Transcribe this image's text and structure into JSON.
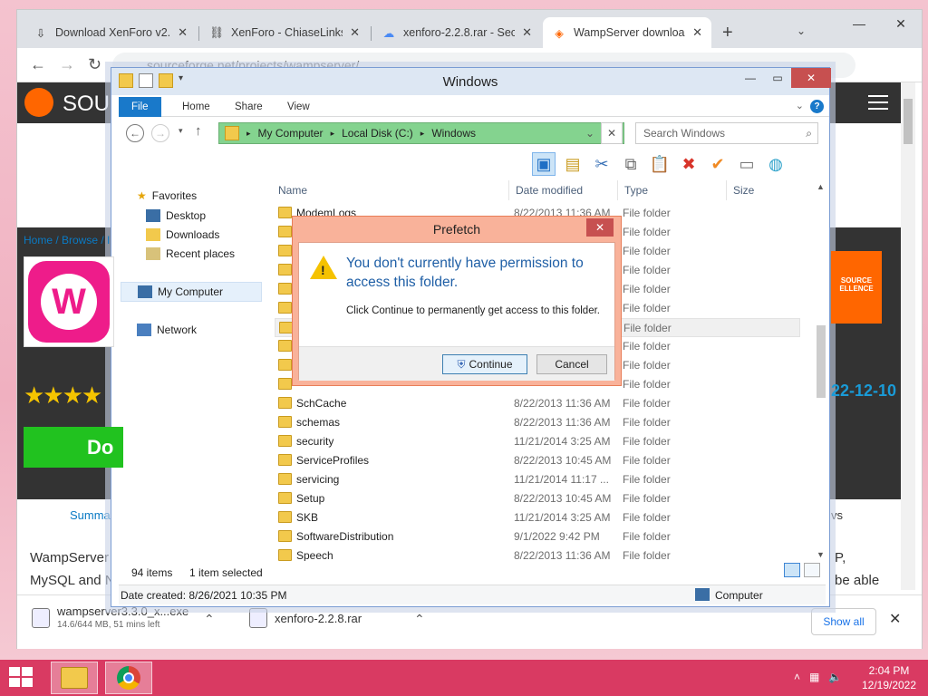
{
  "browser": {
    "tabs": [
      {
        "label": "Download XenForo v2.2",
        "icon": "download-icon"
      },
      {
        "label": "XenForo - ChiaseLinks",
        "icon": "link-icon"
      },
      {
        "label": "xenforo-2.2.8.rar - Secu",
        "icon": "cloud-icon"
      },
      {
        "label": "WampServer download",
        "icon": "sourceforge-icon"
      }
    ],
    "new_tab": "+",
    "url": "sourceforge.net/projects/wampserver/"
  },
  "site": {
    "logo_text": "SOU",
    "breadcrumbs": "Home / Browse / I",
    "download_label": "Do",
    "stars": "★★★★",
    "badge_text": "SOURCE ELLENCE",
    "date_fragment": "22-12-10",
    "summary_tab": "Summa",
    "reviews_fragment": "vs",
    "desc_line1": "WampServer",
    "desc_line2": "MySQL and N",
    "right_line1": "P,",
    "right_line2": "be able"
  },
  "downloads": [
    {
      "name": "wampserver3.3.0_x...exe",
      "sub": "14.6/644 MB, 51 mins left"
    },
    {
      "name": "xenforo-2.2.8.rar",
      "sub": ""
    }
  ],
  "show_all": "Show all",
  "explorer": {
    "title": "Windows",
    "ribbon_tabs": [
      "File",
      "Home",
      "Share",
      "View"
    ],
    "path": [
      "My Computer",
      "Local Disk (C:)",
      "Windows"
    ],
    "search_placeholder": "Search Windows",
    "nav": {
      "favorites": "Favorites",
      "desktop": "Desktop",
      "downloads": "Downloads",
      "recent": "Recent places",
      "computer": "My Computer",
      "network": "Network"
    },
    "columns": [
      "Name",
      "Date modified",
      "Type",
      "Size"
    ],
    "files": [
      {
        "name": "ModemLogs",
        "date": "8/22/2013 11:36 AM",
        "type": "File folder"
      },
      {
        "name": "",
        "date": "",
        "type": "File folder"
      },
      {
        "name": "",
        "date": "",
        "type": "File folder"
      },
      {
        "name": "",
        "date": "",
        "type": "File folder"
      },
      {
        "name": "",
        "date": "",
        "type": "File folder"
      },
      {
        "name": "",
        "date": "",
        "type": "File folder"
      },
      {
        "name": "",
        "date": "",
        "type": "File folder"
      },
      {
        "name": "",
        "date": "",
        "type": "File folder"
      },
      {
        "name": "",
        "date": "",
        "type": "File folder"
      },
      {
        "name": "",
        "date": "",
        "type": "File folder"
      },
      {
        "name": "SchCache",
        "date": "8/22/2013 11:36 AM",
        "type": "File folder"
      },
      {
        "name": "schemas",
        "date": "8/22/2013 11:36 AM",
        "type": "File folder"
      },
      {
        "name": "security",
        "date": "11/21/2014 3:25 AM",
        "type": "File folder"
      },
      {
        "name": "ServiceProfiles",
        "date": "8/22/2013 10:45 AM",
        "type": "File folder"
      },
      {
        "name": "servicing",
        "date": "11/21/2014 11:17 ...",
        "type": "File folder"
      },
      {
        "name": "Setup",
        "date": "8/22/2013 10:45 AM",
        "type": "File folder"
      },
      {
        "name": "SKB",
        "date": "11/21/2014 3:25 AM",
        "type": "File folder"
      },
      {
        "name": "SoftwareDistribution",
        "date": "9/1/2022 9:42 PM",
        "type": "File folder"
      },
      {
        "name": "Speech",
        "date": "8/22/2013 11:36 AM",
        "type": "File folder"
      }
    ],
    "status_items": "94 items",
    "status_selected": "1 item selected",
    "details_date": "Date created: 8/26/2021 10:35 PM",
    "details_location": "Computer"
  },
  "dialog": {
    "title": "Prefetch",
    "main": "You don't currently have permission to access this folder.",
    "sub": "Click Continue to permanently get access to this folder.",
    "continue": "Continue",
    "cancel": "Cancel"
  },
  "taskbar": {
    "time": "2:04 PM",
    "date": "12/19/2022"
  }
}
